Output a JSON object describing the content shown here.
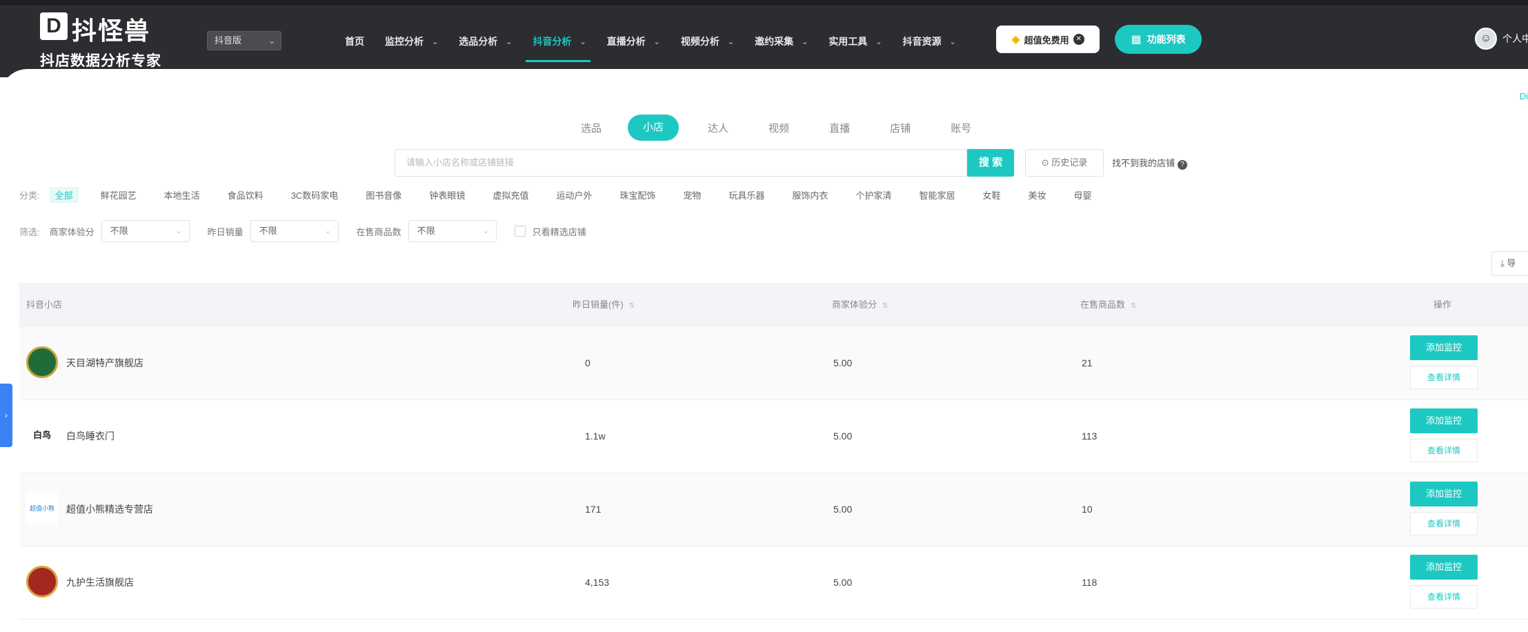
{
  "brand": {
    "mark": "D",
    "name": "抖怪兽",
    "subtitle": "抖店数据分析专家"
  },
  "platform_select": {
    "value": "抖音版",
    "icon": "chevron-down-icon"
  },
  "nav": {
    "items": [
      {
        "label": "首页",
        "has_dropdown": false
      },
      {
        "label": "监控分析",
        "has_dropdown": true
      },
      {
        "label": "选品分析",
        "has_dropdown": true
      },
      {
        "label": "抖音分析",
        "has_dropdown": true,
        "active": true
      },
      {
        "label": "直播分析",
        "has_dropdown": true
      },
      {
        "label": "视频分析",
        "has_dropdown": true
      },
      {
        "label": "邀约采集",
        "has_dropdown": true
      },
      {
        "label": "实用工具",
        "has_dropdown": true
      },
      {
        "label": "抖音资源",
        "has_dropdown": true
      }
    ],
    "vip_label": "超值免费用",
    "menu_label": "功能列表"
  },
  "user": {
    "label": "个人中"
  },
  "corner_link": "Di",
  "search": {
    "tabs": [
      "选品",
      "小店",
      "达人",
      "视频",
      "直播",
      "店铺",
      "账号"
    ],
    "active_tab": 1,
    "placeholder": "请输入小店名称或店铺链接",
    "button": "搜 索",
    "history": "⊙ 历史记录",
    "not_found": "找不到我的店铺"
  },
  "categories": {
    "label": "分类:",
    "items": [
      "全部",
      "鲜花园艺",
      "本地生活",
      "食品饮料",
      "3C数码家电",
      "图书音像",
      "钟表眼镜",
      "虚拟充值",
      "运动户外",
      "珠宝配饰",
      "宠物",
      "玩具乐器",
      "服饰内衣",
      "个护家清",
      "智能家居",
      "女鞋",
      "美妆",
      "母婴"
    ],
    "active": 0
  },
  "filters": {
    "label": "筛选:",
    "items": [
      {
        "name": "商家体验分",
        "value": "不限"
      },
      {
        "name": "昨日销量",
        "value": "不限"
      },
      {
        "name": "在售商品数",
        "value": "不限"
      }
    ],
    "checkbox_label": "只看精选店铺"
  },
  "export_label": "⤓ 导",
  "table": {
    "headers": {
      "shop": "抖音小店",
      "sales": "昨日销量(件)",
      "score": "商家体验分",
      "products": "在售商品数",
      "action": "操作"
    },
    "rows": [
      {
        "name": "天目湖特产旗舰店",
        "sales": "0",
        "score": "5.00",
        "products": "21",
        "logo_color": "#1f6b3a"
      },
      {
        "name": "白鸟睡衣门",
        "sales": "1.1w",
        "score": "5.00",
        "products": "113",
        "logo_color": "#ffffff",
        "logo_text": "白鸟"
      },
      {
        "name": "超值小熊精选专营店",
        "sales": "171",
        "score": "5.00",
        "products": "10",
        "logo_color": "#ffffff",
        "logo_text": "超值小熊"
      },
      {
        "name": "九护生活旗舰店",
        "sales": "4,153",
        "score": "5.00",
        "products": "118",
        "logo_color": "#a3281f"
      }
    ],
    "primary_action": "添加监控",
    "secondary_action": "查看详情"
  },
  "colors": {
    "accent": "#1ec8c2",
    "topbar": "#2b2d31",
    "side_tab": "#3b82f6"
  }
}
